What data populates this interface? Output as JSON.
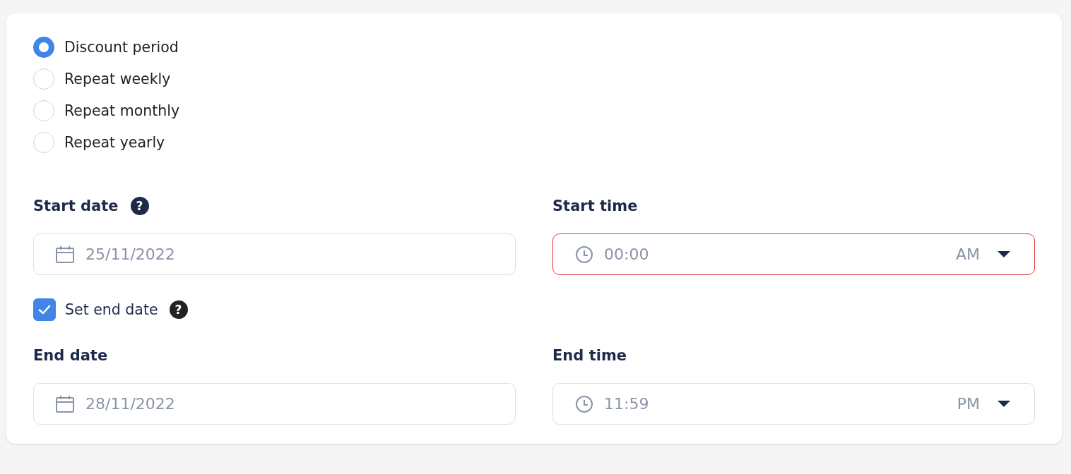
{
  "schedule_options": [
    {
      "label": "Discount period",
      "selected": true
    },
    {
      "label": "Repeat weekly",
      "selected": false
    },
    {
      "label": "Repeat monthly",
      "selected": false
    },
    {
      "label": "Repeat yearly",
      "selected": false
    }
  ],
  "start_fields": [
    {
      "kind": "date",
      "label": "Start date",
      "help": "?",
      "value": "25/11/2022",
      "error": false
    },
    {
      "kind": "time",
      "label": "Start time",
      "value": "00:00",
      "meridiem": "AM",
      "error": true
    }
  ],
  "end_date_toggle": {
    "label": "Set end date",
    "checked": true,
    "help": "?"
  },
  "end_fields": [
    {
      "kind": "date",
      "label": "End date",
      "value": "28/11/2022",
      "error": false
    },
    {
      "kind": "time",
      "label": "End time",
      "value": "11:59",
      "meridiem": "PM",
      "error": false
    }
  ]
}
